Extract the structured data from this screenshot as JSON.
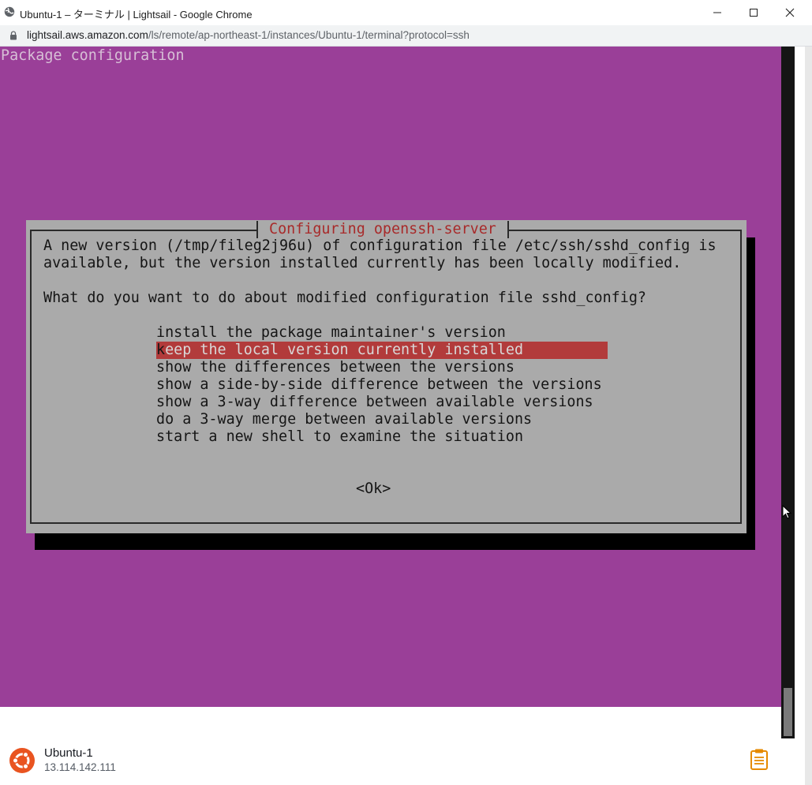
{
  "browser": {
    "window_title": "Ubuntu-1 – ターミナル | Lightsail - Google Chrome",
    "url_host": "lightsail.aws.amazon.com",
    "url_path": "/ls/remote/ap-northeast-1/instances/Ubuntu-1/terminal?protocol=ssh",
    "icons": {
      "favicon": "globe-icon",
      "minimize": "minimize-icon",
      "maximize": "maximize-icon",
      "close": "close-icon",
      "lock": "lock-icon"
    }
  },
  "terminal": {
    "header": "Package configuration",
    "dialog": {
      "title": "Configuring openssh-server",
      "message_line1": "A new version (/tmp/fileg2j96u) of configuration file /etc/ssh/sshd_config is",
      "message_line2": "available, but the version installed currently has been locally modified.",
      "question": "What do you want to do about modified configuration file sshd_config?",
      "options": [
        "install the package maintainer's version",
        "keep the local version currently installed",
        "show the differences between the versions",
        "show a side-by-side difference between the versions",
        "show a 3-way difference between available versions",
        "do a 3-way merge between available versions",
        "start a new shell to examine the situation"
      ],
      "selected_index": 1,
      "selected_first_char": "k",
      "selected_rest": "eep the local version currently installed",
      "ok_label": "<Ok>"
    },
    "colors": {
      "background": "#9a3f98",
      "dialog": "#aaaaaa",
      "title_text": "#a82a2a",
      "selected_bg": "#b23b3b"
    }
  },
  "footer": {
    "instance_name": "Ubuntu-1",
    "instance_ip": "13.114.142.111",
    "icons": {
      "os": "ubuntu-logo-icon",
      "clipboard": "clipboard-icon"
    }
  }
}
